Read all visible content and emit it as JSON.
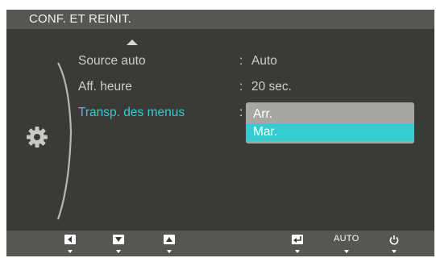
{
  "window": {
    "title": "CONF. ET REINIT."
  },
  "menu": {
    "items": [
      {
        "label": "Source auto",
        "value": "Auto"
      },
      {
        "label": "Aff. heure",
        "value": "20 sec."
      },
      {
        "label": "Transp. des menus",
        "value": ""
      }
    ],
    "separator": ":",
    "selected_index": 2
  },
  "dropdown": {
    "options": [
      "Arr.",
      "Mar."
    ],
    "highlighted": "Mar."
  },
  "bottom_bar": {
    "buttons": [
      {
        "icon": "left-arrow-icon"
      },
      {
        "icon": "down-arrow-icon"
      },
      {
        "icon": "up-arrow-icon"
      },
      {
        "icon": "enter-icon"
      },
      {
        "icon": "auto-text",
        "label": "AUTO"
      },
      {
        "icon": "power-icon"
      }
    ]
  },
  "colors": {
    "background": "#3c3a37",
    "bar": "#585652",
    "accent": "#34cccf",
    "text": "#cfcdc8"
  }
}
